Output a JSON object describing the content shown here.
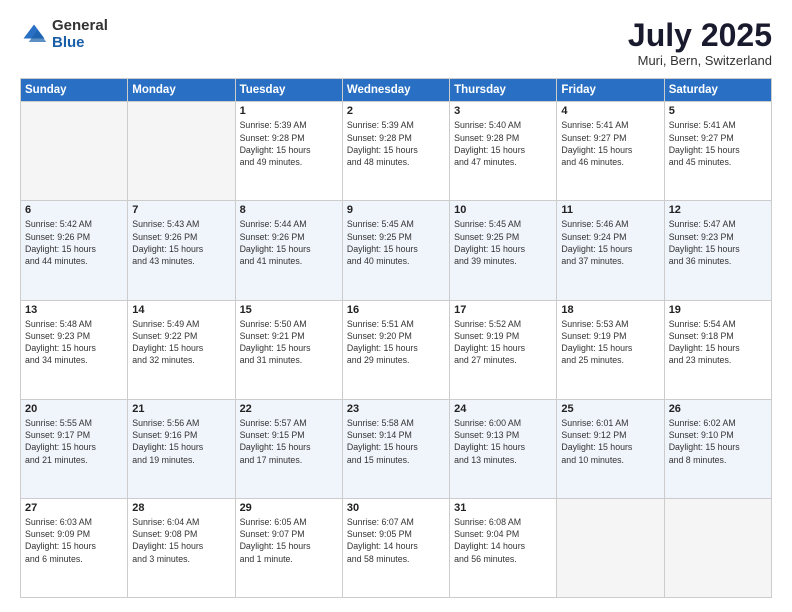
{
  "logo": {
    "general": "General",
    "blue": "Blue"
  },
  "header": {
    "month": "July 2025",
    "location": "Muri, Bern, Switzerland"
  },
  "weekdays": [
    "Sunday",
    "Monday",
    "Tuesday",
    "Wednesday",
    "Thursday",
    "Friday",
    "Saturday"
  ],
  "weeks": [
    [
      {
        "day": "",
        "detail": ""
      },
      {
        "day": "",
        "detail": ""
      },
      {
        "day": "1",
        "detail": "Sunrise: 5:39 AM\nSunset: 9:28 PM\nDaylight: 15 hours\nand 49 minutes."
      },
      {
        "day": "2",
        "detail": "Sunrise: 5:39 AM\nSunset: 9:28 PM\nDaylight: 15 hours\nand 48 minutes."
      },
      {
        "day": "3",
        "detail": "Sunrise: 5:40 AM\nSunset: 9:28 PM\nDaylight: 15 hours\nand 47 minutes."
      },
      {
        "day": "4",
        "detail": "Sunrise: 5:41 AM\nSunset: 9:27 PM\nDaylight: 15 hours\nand 46 minutes."
      },
      {
        "day": "5",
        "detail": "Sunrise: 5:41 AM\nSunset: 9:27 PM\nDaylight: 15 hours\nand 45 minutes."
      }
    ],
    [
      {
        "day": "6",
        "detail": "Sunrise: 5:42 AM\nSunset: 9:26 PM\nDaylight: 15 hours\nand 44 minutes."
      },
      {
        "day": "7",
        "detail": "Sunrise: 5:43 AM\nSunset: 9:26 PM\nDaylight: 15 hours\nand 43 minutes."
      },
      {
        "day": "8",
        "detail": "Sunrise: 5:44 AM\nSunset: 9:26 PM\nDaylight: 15 hours\nand 41 minutes."
      },
      {
        "day": "9",
        "detail": "Sunrise: 5:45 AM\nSunset: 9:25 PM\nDaylight: 15 hours\nand 40 minutes."
      },
      {
        "day": "10",
        "detail": "Sunrise: 5:45 AM\nSunset: 9:25 PM\nDaylight: 15 hours\nand 39 minutes."
      },
      {
        "day": "11",
        "detail": "Sunrise: 5:46 AM\nSunset: 9:24 PM\nDaylight: 15 hours\nand 37 minutes."
      },
      {
        "day": "12",
        "detail": "Sunrise: 5:47 AM\nSunset: 9:23 PM\nDaylight: 15 hours\nand 36 minutes."
      }
    ],
    [
      {
        "day": "13",
        "detail": "Sunrise: 5:48 AM\nSunset: 9:23 PM\nDaylight: 15 hours\nand 34 minutes."
      },
      {
        "day": "14",
        "detail": "Sunrise: 5:49 AM\nSunset: 9:22 PM\nDaylight: 15 hours\nand 32 minutes."
      },
      {
        "day": "15",
        "detail": "Sunrise: 5:50 AM\nSunset: 9:21 PM\nDaylight: 15 hours\nand 31 minutes."
      },
      {
        "day": "16",
        "detail": "Sunrise: 5:51 AM\nSunset: 9:20 PM\nDaylight: 15 hours\nand 29 minutes."
      },
      {
        "day": "17",
        "detail": "Sunrise: 5:52 AM\nSunset: 9:19 PM\nDaylight: 15 hours\nand 27 minutes."
      },
      {
        "day": "18",
        "detail": "Sunrise: 5:53 AM\nSunset: 9:19 PM\nDaylight: 15 hours\nand 25 minutes."
      },
      {
        "day": "19",
        "detail": "Sunrise: 5:54 AM\nSunset: 9:18 PM\nDaylight: 15 hours\nand 23 minutes."
      }
    ],
    [
      {
        "day": "20",
        "detail": "Sunrise: 5:55 AM\nSunset: 9:17 PM\nDaylight: 15 hours\nand 21 minutes."
      },
      {
        "day": "21",
        "detail": "Sunrise: 5:56 AM\nSunset: 9:16 PM\nDaylight: 15 hours\nand 19 minutes."
      },
      {
        "day": "22",
        "detail": "Sunrise: 5:57 AM\nSunset: 9:15 PM\nDaylight: 15 hours\nand 17 minutes."
      },
      {
        "day": "23",
        "detail": "Sunrise: 5:58 AM\nSunset: 9:14 PM\nDaylight: 15 hours\nand 15 minutes."
      },
      {
        "day": "24",
        "detail": "Sunrise: 6:00 AM\nSunset: 9:13 PM\nDaylight: 15 hours\nand 13 minutes."
      },
      {
        "day": "25",
        "detail": "Sunrise: 6:01 AM\nSunset: 9:12 PM\nDaylight: 15 hours\nand 10 minutes."
      },
      {
        "day": "26",
        "detail": "Sunrise: 6:02 AM\nSunset: 9:10 PM\nDaylight: 15 hours\nand 8 minutes."
      }
    ],
    [
      {
        "day": "27",
        "detail": "Sunrise: 6:03 AM\nSunset: 9:09 PM\nDaylight: 15 hours\nand 6 minutes."
      },
      {
        "day": "28",
        "detail": "Sunrise: 6:04 AM\nSunset: 9:08 PM\nDaylight: 15 hours\nand 3 minutes."
      },
      {
        "day": "29",
        "detail": "Sunrise: 6:05 AM\nSunset: 9:07 PM\nDaylight: 15 hours\nand 1 minute."
      },
      {
        "day": "30",
        "detail": "Sunrise: 6:07 AM\nSunset: 9:05 PM\nDaylight: 14 hours\nand 58 minutes."
      },
      {
        "day": "31",
        "detail": "Sunrise: 6:08 AM\nSunset: 9:04 PM\nDaylight: 14 hours\nand 56 minutes."
      },
      {
        "day": "",
        "detail": ""
      },
      {
        "day": "",
        "detail": ""
      }
    ]
  ]
}
